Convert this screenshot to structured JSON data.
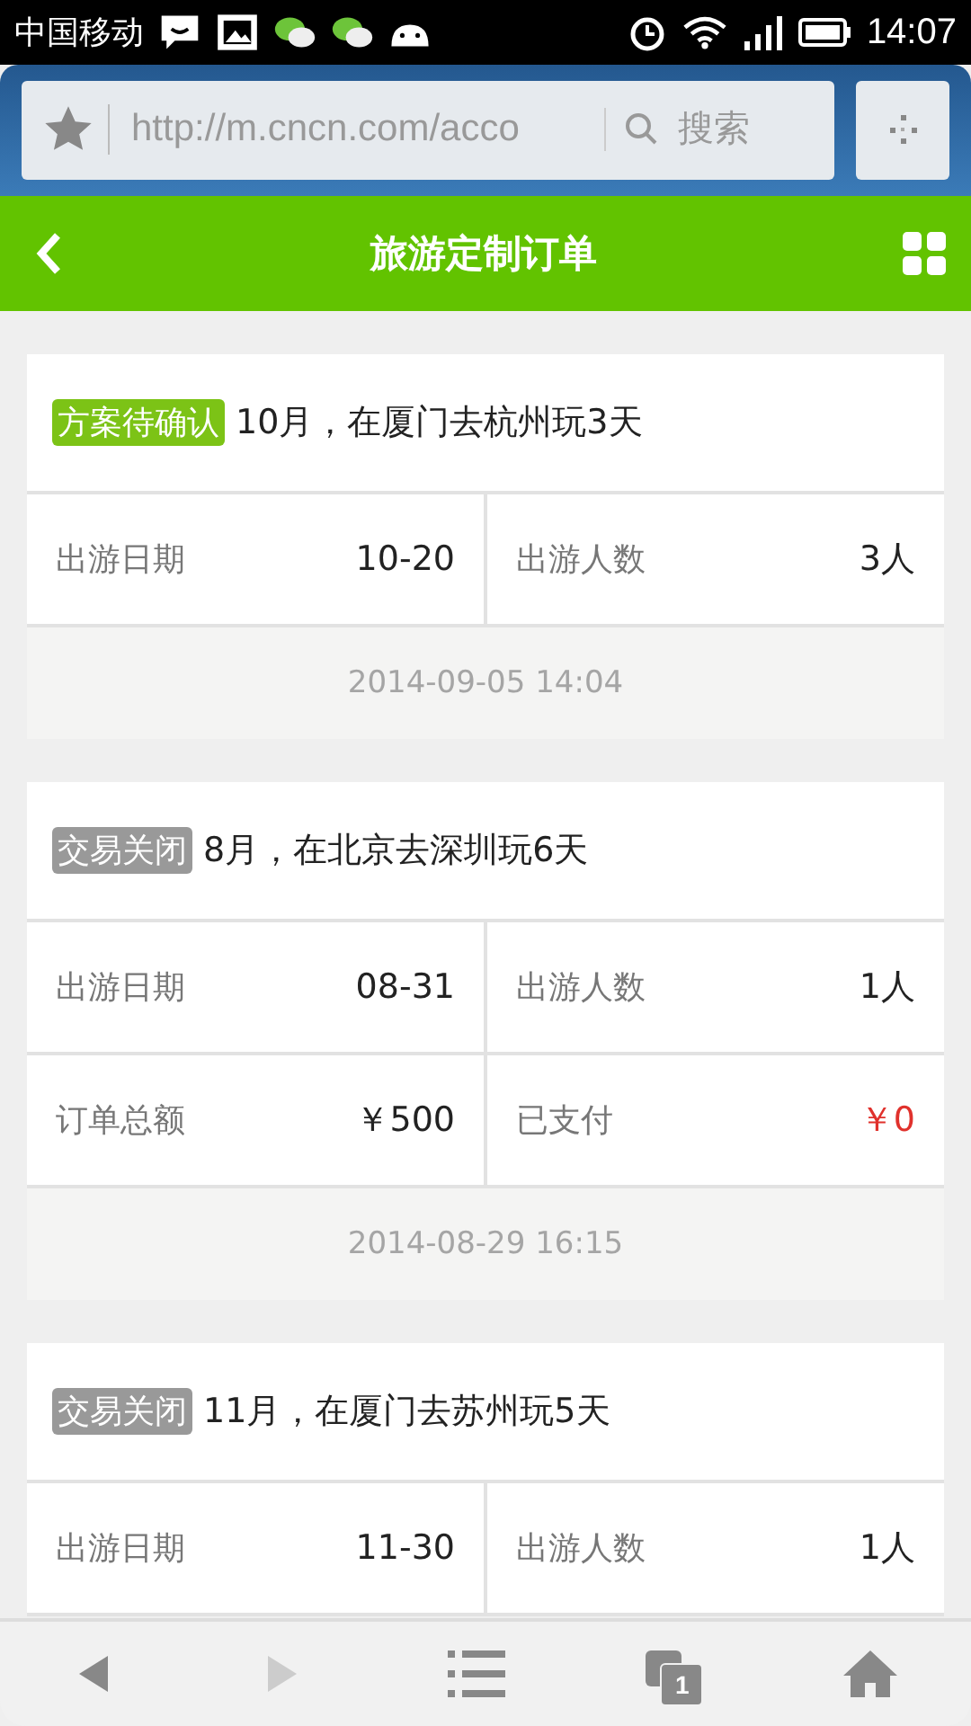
{
  "status_bar": {
    "carrier": "中国移动",
    "time": "14:07"
  },
  "browser": {
    "url": "http://m.cncn.com/acco",
    "search_placeholder": "搜索"
  },
  "header": {
    "title": "旅游定制订单"
  },
  "orders": [
    {
      "status": "方案待确认",
      "color": "#7cc316",
      "title": "10月，在厦门去杭州玩3天",
      "rows": [
        [
          {
            "label": "出游日期",
            "value": "10-20",
            "alert": false
          },
          {
            "label": "出游人数",
            "value": "3人",
            "alert": false
          }
        ]
      ],
      "time": "2014-09-05 14:04"
    },
    {
      "status": "交易关闭",
      "color": "#999999",
      "title": "8月，在北京去深圳玩6天",
      "rows": [
        [
          {
            "label": "出游日期",
            "value": "08-31",
            "alert": false
          },
          {
            "label": "出游人数",
            "value": "1人",
            "alert": false
          }
        ],
        [
          {
            "label": "订单总额",
            "value": "￥500",
            "alert": false
          },
          {
            "label": "已支付",
            "value": "￥0",
            "alert": true
          }
        ]
      ],
      "time": "2014-08-29 16:15"
    },
    {
      "status": "交易关闭",
      "color": "#999999",
      "title": "11月，在厦门去苏州玩5天",
      "rows": [
        [
          {
            "label": "出游日期",
            "value": "11-30",
            "alert": false
          },
          {
            "label": "出游人数",
            "value": "1人",
            "alert": false
          }
        ]
      ]
    }
  ],
  "toolbar": {
    "back_disabled": false,
    "forward_disabled": true,
    "tab_count": "1"
  }
}
